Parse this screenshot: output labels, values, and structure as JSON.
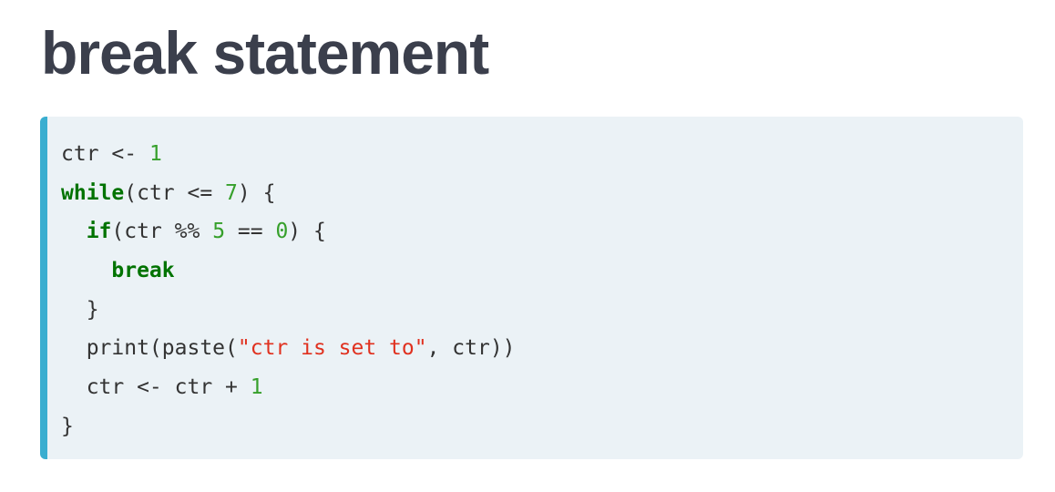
{
  "slide": {
    "title": "break statement"
  },
  "code": {
    "language": "r",
    "lines": [
      [
        {
          "t": "plain",
          "v": "ctr <- "
        },
        {
          "t": "num",
          "v": "1"
        }
      ],
      [
        {
          "t": "kw",
          "v": "while"
        },
        {
          "t": "plain",
          "v": "(ctr <= "
        },
        {
          "t": "num",
          "v": "7"
        },
        {
          "t": "plain",
          "v": ") {"
        }
      ],
      [
        {
          "t": "plain",
          "v": "  "
        },
        {
          "t": "kw",
          "v": "if"
        },
        {
          "t": "plain",
          "v": "(ctr %% "
        },
        {
          "t": "num",
          "v": "5"
        },
        {
          "t": "plain",
          "v": " == "
        },
        {
          "t": "num",
          "v": "0"
        },
        {
          "t": "plain",
          "v": ") {"
        }
      ],
      [
        {
          "t": "plain",
          "v": "    "
        },
        {
          "t": "kw",
          "v": "break"
        }
      ],
      [
        {
          "t": "plain",
          "v": "  }"
        }
      ],
      [
        {
          "t": "plain",
          "v": "  print(paste("
        },
        {
          "t": "str",
          "v": "\"ctr is set to\""
        },
        {
          "t": "plain",
          "v": ", ctr))"
        }
      ],
      [
        {
          "t": "plain",
          "v": "  ctr <- ctr + "
        },
        {
          "t": "num",
          "v": "1"
        }
      ],
      [
        {
          "t": "plain",
          "v": "}"
        }
      ]
    ]
  },
  "colors": {
    "title": "#3b3f4c",
    "code_background": "#ebf2f6",
    "code_accent_border": "#3aaed0",
    "keyword": "#007300",
    "number": "#36a02b",
    "string": "#e0311f",
    "text": "#333333"
  }
}
